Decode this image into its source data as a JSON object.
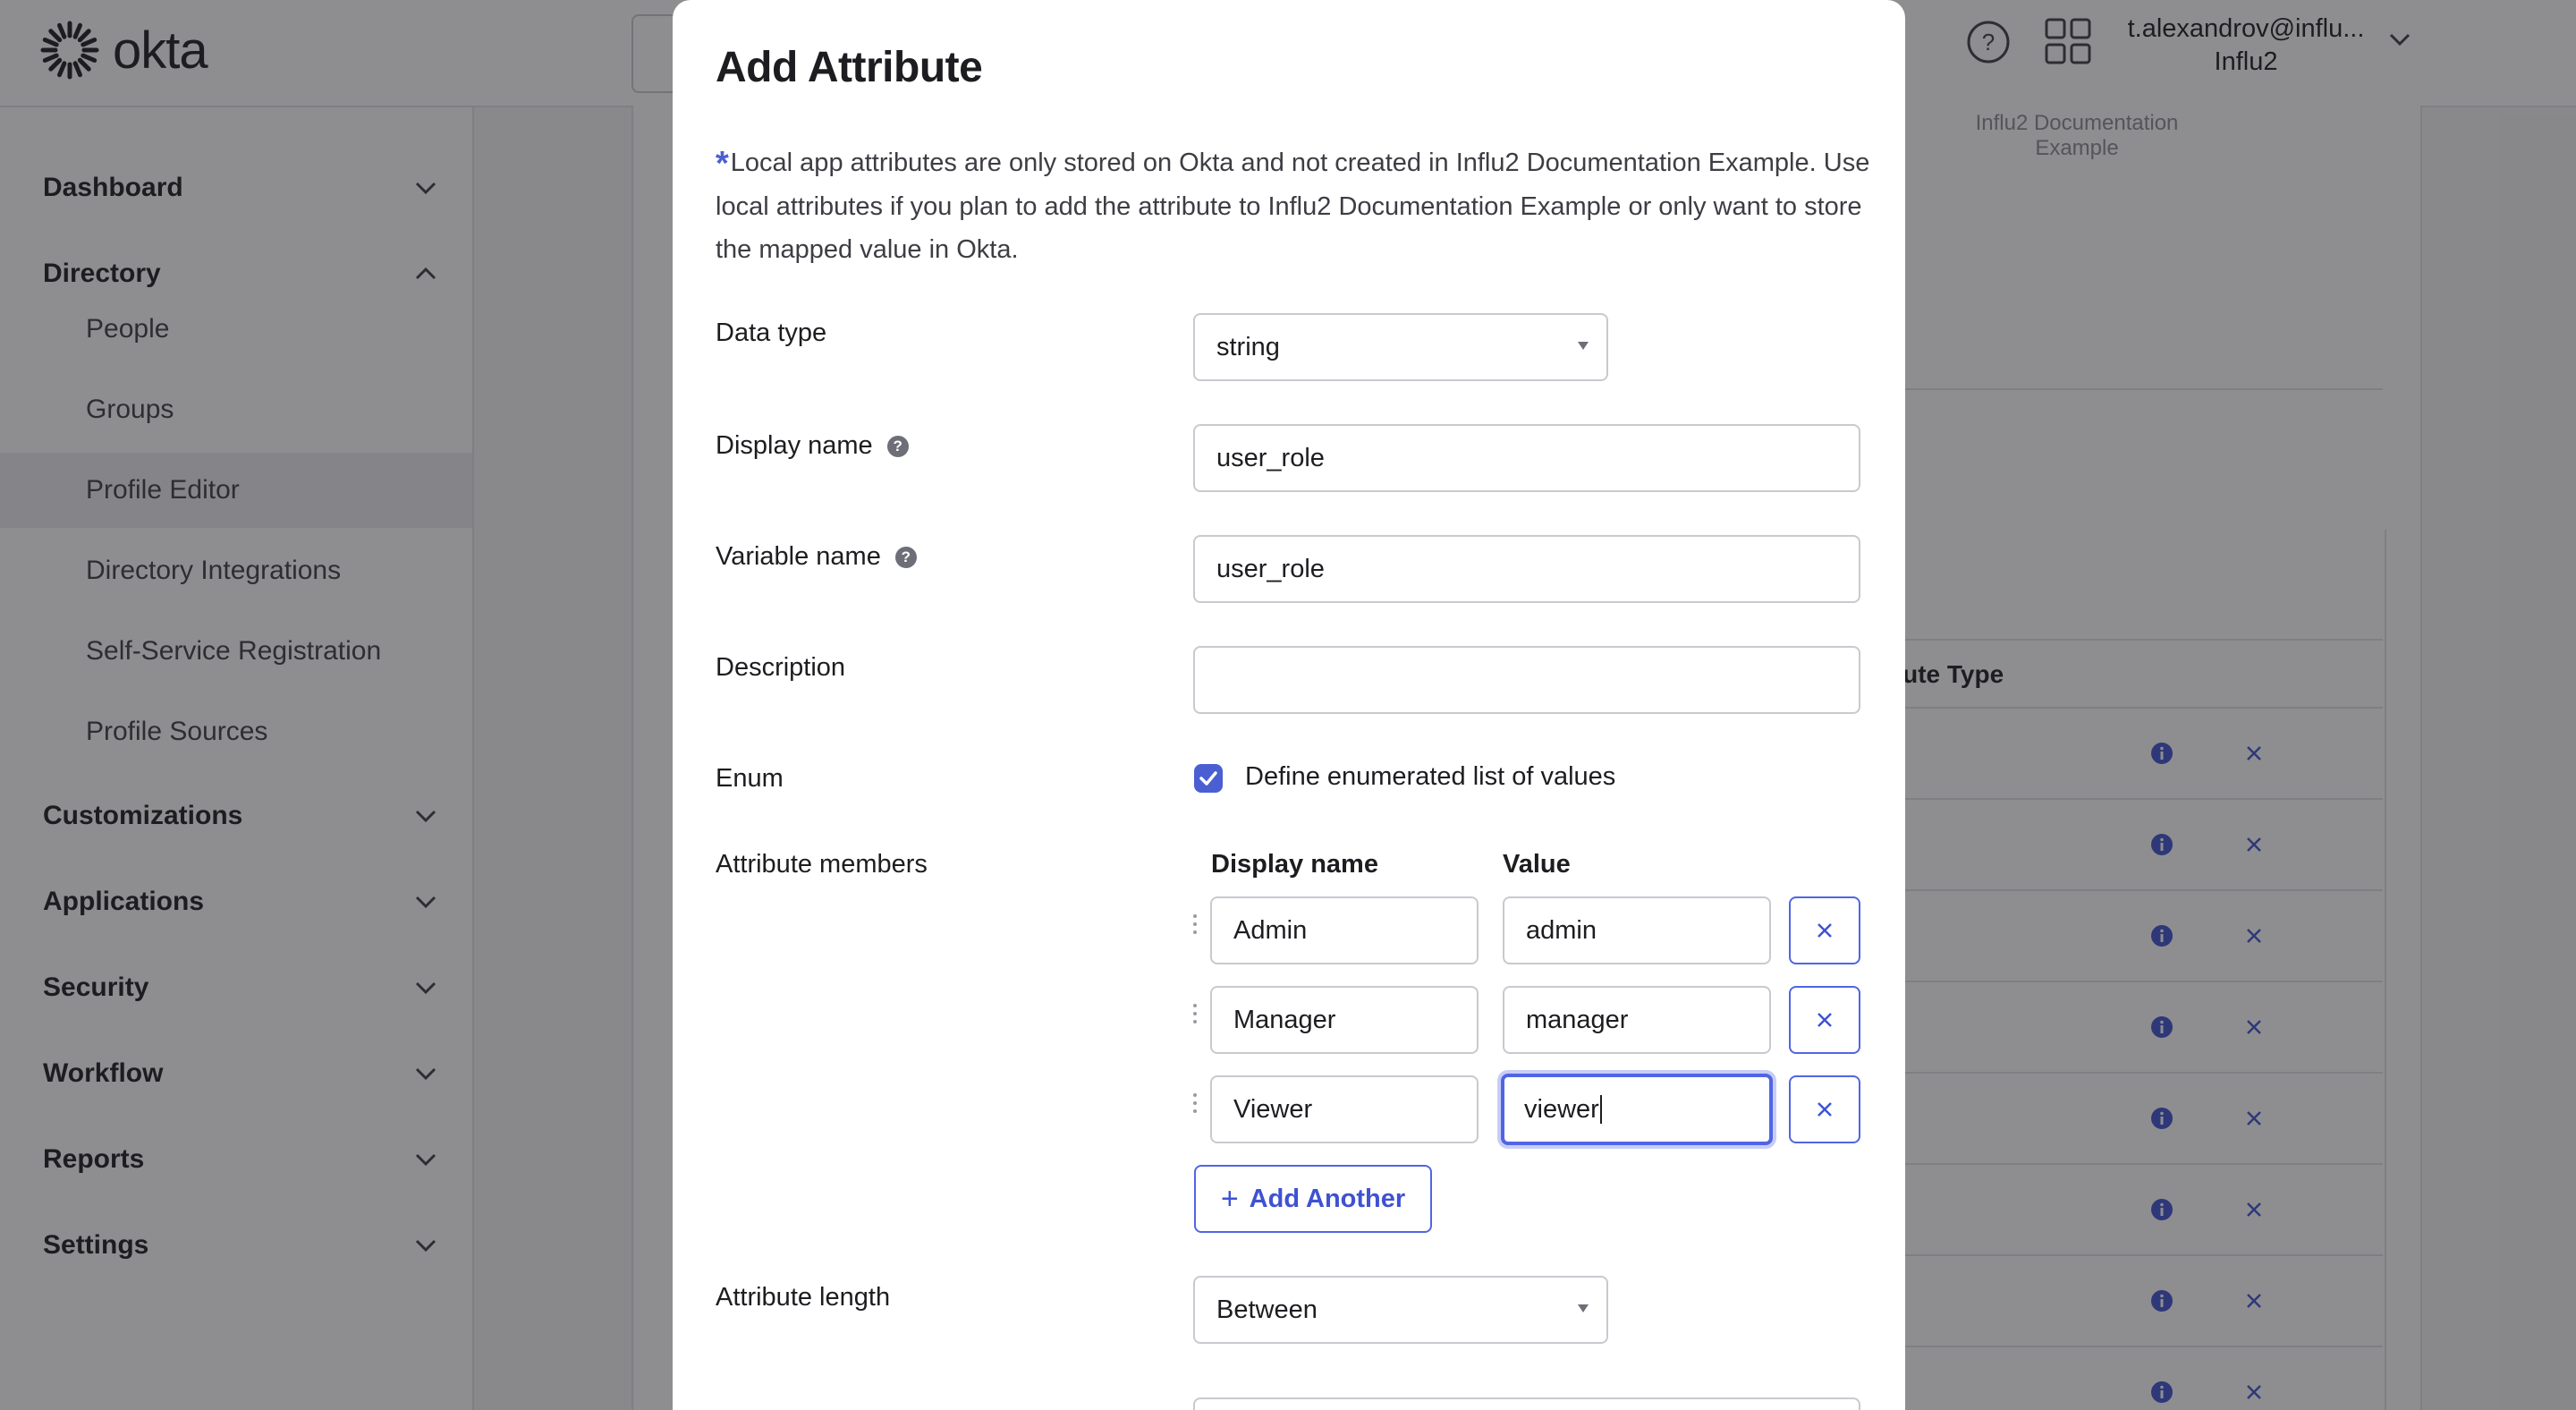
{
  "app": {
    "logo_text": "okta",
    "user_email": "t.alexandrov@influ...",
    "user_org": "Influ2"
  },
  "sidebar": {
    "sections": [
      {
        "label": "Dashboard",
        "expanded": false
      },
      {
        "label": "Directory",
        "expanded": true
      },
      {
        "label": "Customizations",
        "expanded": false
      },
      {
        "label": "Applications",
        "expanded": false
      },
      {
        "label": "Security",
        "expanded": false
      },
      {
        "label": "Workflow",
        "expanded": false
      },
      {
        "label": "Reports",
        "expanded": false
      },
      {
        "label": "Settings",
        "expanded": false
      }
    ],
    "directory_items": [
      {
        "label": "People",
        "active": false
      },
      {
        "label": "Groups",
        "active": false
      },
      {
        "label": "Profile Editor",
        "active": true
      },
      {
        "label": "Directory Integrations",
        "active": false
      },
      {
        "label": "Self-Service Registration",
        "active": false
      },
      {
        "label": "Profile Sources",
        "active": false
      }
    ]
  },
  "background_panel": {
    "app_label": "Influ2 Documentation Example",
    "column_header_fragment": "bute Type",
    "row_fragment": "e"
  },
  "modal": {
    "title": "Add Attribute",
    "note": "Local app attributes are only stored on Okta and not created in Influ2 Documentation Example. Use local attributes if you plan to add the attribute to Influ2 Documentation Example or only want to store the mapped value in Okta.",
    "fields": {
      "data_type": {
        "label": "Data type",
        "value": "string"
      },
      "display_name": {
        "label": "Display name",
        "value": "user_role"
      },
      "variable_name": {
        "label": "Variable name",
        "value": "user_role"
      },
      "description": {
        "label": "Description",
        "value": ""
      },
      "enum": {
        "label": "Enum",
        "checkbox_label": "Define enumerated list of values",
        "checked": true
      },
      "attribute_members": {
        "label": "Attribute members",
        "col_display_name": "Display name",
        "col_value": "Value",
        "members": [
          {
            "display_name": "Admin",
            "value": "admin"
          },
          {
            "display_name": "Manager",
            "value": "manager"
          },
          {
            "display_name": "Viewer",
            "value": "viewer"
          }
        ],
        "add_button": "Add Another"
      },
      "attribute_length": {
        "label": "Attribute length",
        "value": "Between"
      }
    }
  },
  "colors": {
    "accent": "#4a5fd1",
    "overlay": "rgba(29,29,33,0.5)"
  }
}
